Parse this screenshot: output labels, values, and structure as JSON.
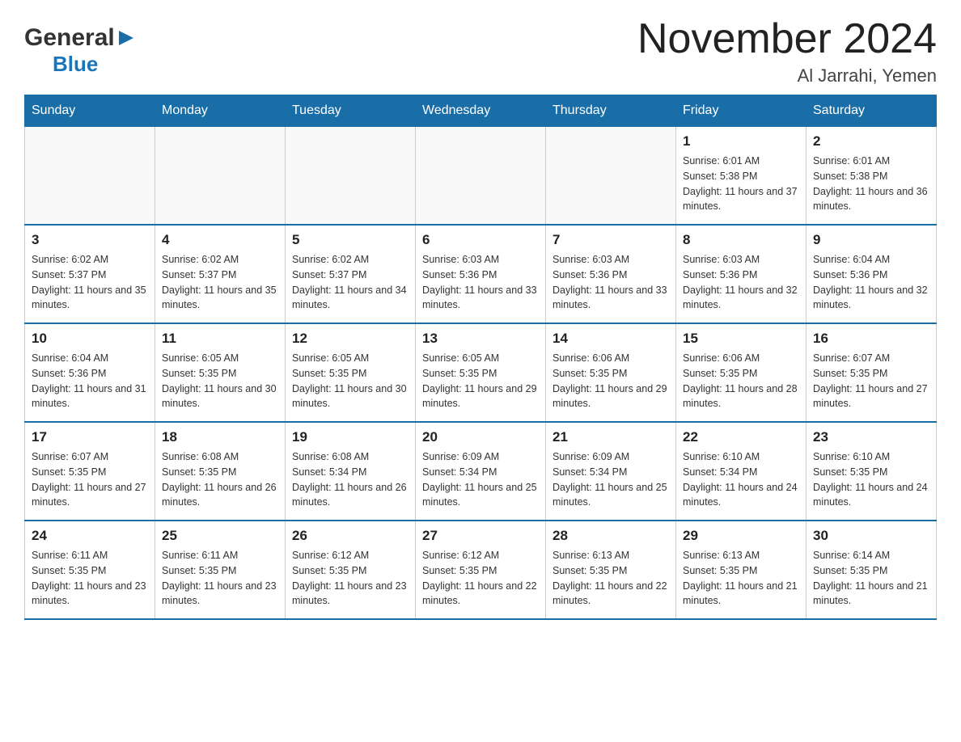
{
  "header": {
    "logo_general": "General",
    "logo_blue": "Blue",
    "title": "November 2024",
    "subtitle": "Al Jarrahi, Yemen"
  },
  "weekdays": [
    "Sunday",
    "Monday",
    "Tuesday",
    "Wednesday",
    "Thursday",
    "Friday",
    "Saturday"
  ],
  "weeks": [
    [
      {
        "day": "",
        "sunrise": "",
        "sunset": "",
        "daylight": ""
      },
      {
        "day": "",
        "sunrise": "",
        "sunset": "",
        "daylight": ""
      },
      {
        "day": "",
        "sunrise": "",
        "sunset": "",
        "daylight": ""
      },
      {
        "day": "",
        "sunrise": "",
        "sunset": "",
        "daylight": ""
      },
      {
        "day": "",
        "sunrise": "",
        "sunset": "",
        "daylight": ""
      },
      {
        "day": "1",
        "sunrise": "Sunrise: 6:01 AM",
        "sunset": "Sunset: 5:38 PM",
        "daylight": "Daylight: 11 hours and 37 minutes."
      },
      {
        "day": "2",
        "sunrise": "Sunrise: 6:01 AM",
        "sunset": "Sunset: 5:38 PM",
        "daylight": "Daylight: 11 hours and 36 minutes."
      }
    ],
    [
      {
        "day": "3",
        "sunrise": "Sunrise: 6:02 AM",
        "sunset": "Sunset: 5:37 PM",
        "daylight": "Daylight: 11 hours and 35 minutes."
      },
      {
        "day": "4",
        "sunrise": "Sunrise: 6:02 AM",
        "sunset": "Sunset: 5:37 PM",
        "daylight": "Daylight: 11 hours and 35 minutes."
      },
      {
        "day": "5",
        "sunrise": "Sunrise: 6:02 AM",
        "sunset": "Sunset: 5:37 PM",
        "daylight": "Daylight: 11 hours and 34 minutes."
      },
      {
        "day": "6",
        "sunrise": "Sunrise: 6:03 AM",
        "sunset": "Sunset: 5:36 PM",
        "daylight": "Daylight: 11 hours and 33 minutes."
      },
      {
        "day": "7",
        "sunrise": "Sunrise: 6:03 AM",
        "sunset": "Sunset: 5:36 PM",
        "daylight": "Daylight: 11 hours and 33 minutes."
      },
      {
        "day": "8",
        "sunrise": "Sunrise: 6:03 AM",
        "sunset": "Sunset: 5:36 PM",
        "daylight": "Daylight: 11 hours and 32 minutes."
      },
      {
        "day": "9",
        "sunrise": "Sunrise: 6:04 AM",
        "sunset": "Sunset: 5:36 PM",
        "daylight": "Daylight: 11 hours and 32 minutes."
      }
    ],
    [
      {
        "day": "10",
        "sunrise": "Sunrise: 6:04 AM",
        "sunset": "Sunset: 5:36 PM",
        "daylight": "Daylight: 11 hours and 31 minutes."
      },
      {
        "day": "11",
        "sunrise": "Sunrise: 6:05 AM",
        "sunset": "Sunset: 5:35 PM",
        "daylight": "Daylight: 11 hours and 30 minutes."
      },
      {
        "day": "12",
        "sunrise": "Sunrise: 6:05 AM",
        "sunset": "Sunset: 5:35 PM",
        "daylight": "Daylight: 11 hours and 30 minutes."
      },
      {
        "day": "13",
        "sunrise": "Sunrise: 6:05 AM",
        "sunset": "Sunset: 5:35 PM",
        "daylight": "Daylight: 11 hours and 29 minutes."
      },
      {
        "day": "14",
        "sunrise": "Sunrise: 6:06 AM",
        "sunset": "Sunset: 5:35 PM",
        "daylight": "Daylight: 11 hours and 29 minutes."
      },
      {
        "day": "15",
        "sunrise": "Sunrise: 6:06 AM",
        "sunset": "Sunset: 5:35 PM",
        "daylight": "Daylight: 11 hours and 28 minutes."
      },
      {
        "day": "16",
        "sunrise": "Sunrise: 6:07 AM",
        "sunset": "Sunset: 5:35 PM",
        "daylight": "Daylight: 11 hours and 27 minutes."
      }
    ],
    [
      {
        "day": "17",
        "sunrise": "Sunrise: 6:07 AM",
        "sunset": "Sunset: 5:35 PM",
        "daylight": "Daylight: 11 hours and 27 minutes."
      },
      {
        "day": "18",
        "sunrise": "Sunrise: 6:08 AM",
        "sunset": "Sunset: 5:35 PM",
        "daylight": "Daylight: 11 hours and 26 minutes."
      },
      {
        "day": "19",
        "sunrise": "Sunrise: 6:08 AM",
        "sunset": "Sunset: 5:34 PM",
        "daylight": "Daylight: 11 hours and 26 minutes."
      },
      {
        "day": "20",
        "sunrise": "Sunrise: 6:09 AM",
        "sunset": "Sunset: 5:34 PM",
        "daylight": "Daylight: 11 hours and 25 minutes."
      },
      {
        "day": "21",
        "sunrise": "Sunrise: 6:09 AM",
        "sunset": "Sunset: 5:34 PM",
        "daylight": "Daylight: 11 hours and 25 minutes."
      },
      {
        "day": "22",
        "sunrise": "Sunrise: 6:10 AM",
        "sunset": "Sunset: 5:34 PM",
        "daylight": "Daylight: 11 hours and 24 minutes."
      },
      {
        "day": "23",
        "sunrise": "Sunrise: 6:10 AM",
        "sunset": "Sunset: 5:35 PM",
        "daylight": "Daylight: 11 hours and 24 minutes."
      }
    ],
    [
      {
        "day": "24",
        "sunrise": "Sunrise: 6:11 AM",
        "sunset": "Sunset: 5:35 PM",
        "daylight": "Daylight: 11 hours and 23 minutes."
      },
      {
        "day": "25",
        "sunrise": "Sunrise: 6:11 AM",
        "sunset": "Sunset: 5:35 PM",
        "daylight": "Daylight: 11 hours and 23 minutes."
      },
      {
        "day": "26",
        "sunrise": "Sunrise: 6:12 AM",
        "sunset": "Sunset: 5:35 PM",
        "daylight": "Daylight: 11 hours and 23 minutes."
      },
      {
        "day": "27",
        "sunrise": "Sunrise: 6:12 AM",
        "sunset": "Sunset: 5:35 PM",
        "daylight": "Daylight: 11 hours and 22 minutes."
      },
      {
        "day": "28",
        "sunrise": "Sunrise: 6:13 AM",
        "sunset": "Sunset: 5:35 PM",
        "daylight": "Daylight: 11 hours and 22 minutes."
      },
      {
        "day": "29",
        "sunrise": "Sunrise: 6:13 AM",
        "sunset": "Sunset: 5:35 PM",
        "daylight": "Daylight: 11 hours and 21 minutes."
      },
      {
        "day": "30",
        "sunrise": "Sunrise: 6:14 AM",
        "sunset": "Sunset: 5:35 PM",
        "daylight": "Daylight: 11 hours and 21 minutes."
      }
    ]
  ]
}
